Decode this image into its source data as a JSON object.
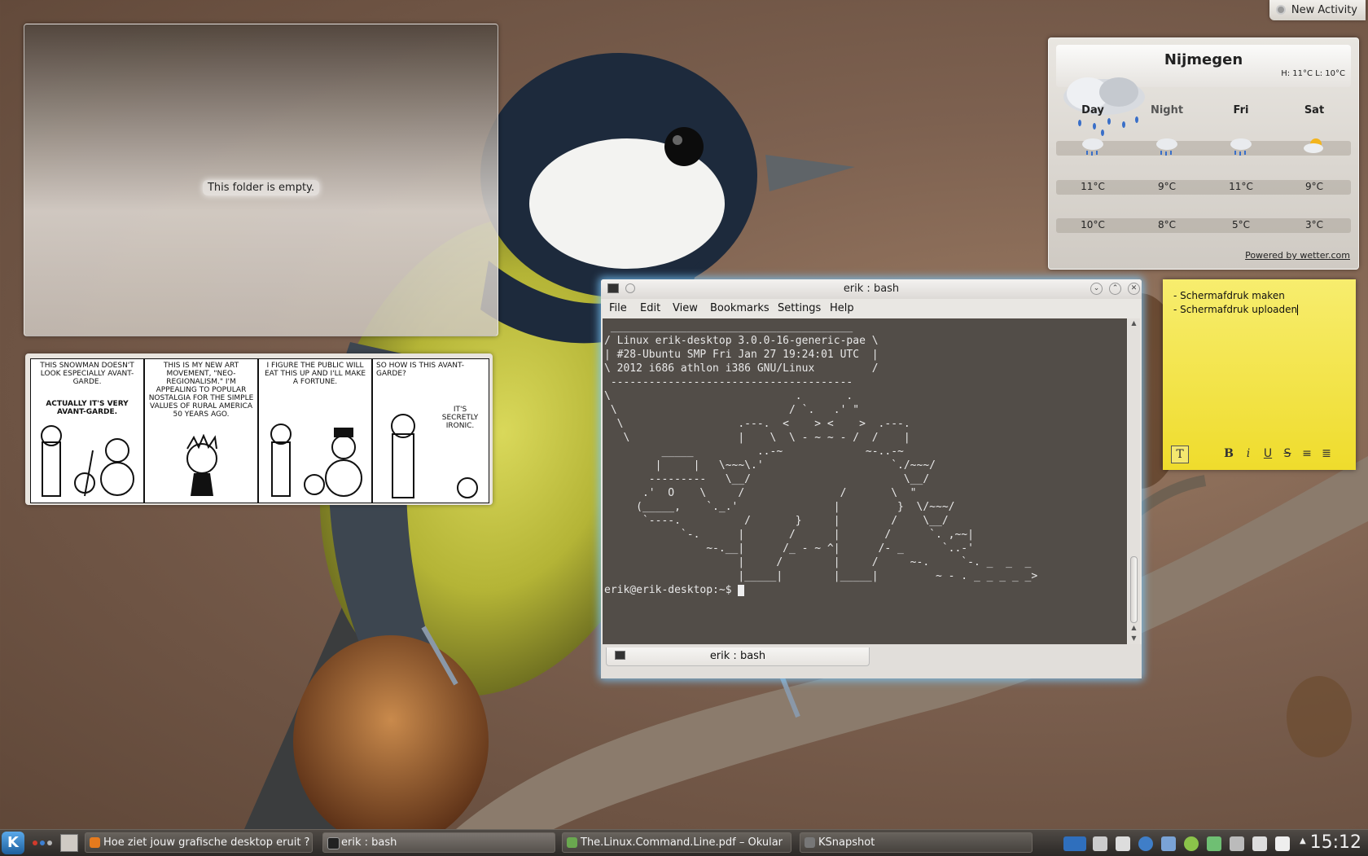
{
  "folderview": {
    "empty_text": "This folder is empty."
  },
  "comic": {
    "panels": [
      {
        "caption": "This snowman doesn't look especially avant-garde.",
        "bubble": "Actually it's very avant-garde."
      },
      {
        "caption": "This is my new art movement, \"Neo-Regionalism.\" I'm appealing to popular nostalgia for the simple values of rural America 50 years ago.",
        "bubble": ""
      },
      {
        "caption": "I figure the public will eat this up and I'll make a fortune.",
        "bubble": ""
      },
      {
        "caption": "So how is this avant-garde?",
        "bubble": "It's secretly ironic."
      }
    ]
  },
  "activity": {
    "label": "New Activity"
  },
  "weather": {
    "city": "Nijmegen",
    "high_low": "H: 11°C L: 10°C",
    "days": [
      "Day",
      "Night",
      "Fri",
      "Sat"
    ],
    "highs": [
      "11°C",
      "9°C",
      "11°C",
      "9°C"
    ],
    "lows": [
      "10°C",
      "8°C",
      "5°C",
      "3°C"
    ],
    "powered_by": "Powered by wetter.com"
  },
  "note": {
    "lines": [
      "- Schermafdruk maken",
      "- Schermafdruk uploaden"
    ],
    "tools": [
      "T",
      "B",
      "i",
      "U",
      "S",
      "≡",
      "≣"
    ]
  },
  "konsole": {
    "title": "erik : bash",
    "menu": [
      "File",
      "Edit",
      "View",
      "Bookmarks",
      "Settings",
      "Help"
    ],
    "terminal_text": " ______________________________________\n/ Linux erik-desktop 3.0.0-16-generic-pae \\\n| #28-Ubuntu SMP Fri Jan 27 19:24:01 UTC  |\n\\ 2012 i686 athlon i386 GNU/Linux         /\n --------------------------------------\n\\                             .       .\n \\                           / `.   .' \"\n  \\                  .---.  <    > <    >  .---.\n   \\                 |    \\  \\ - ~ ~ - /  /    |\n         _____          ..-~             ~-..-~\n        |     |   \\~~~\\.'                    `./~~~/\n       ---------   \\__/                        \\__/\n      .'  O    \\     /               /       \\  \"\n     (_____,    `._.'               |         }  \\/~~~/\n      `----.          /       }     |        /    \\__/\n            `-.      |       /      |       /      `. ,~~|\n                ~-.__|      /_ - ~ ^|      /- _      `..-'\n                     |     /        |     /     ~-.     `-. _  _  _\n                     |_____|        |_____|         ~ - . _ _ _ _ _>\n",
    "prompt": "erik@erik-desktop:~$ ",
    "tab_label": "erik : bash"
  },
  "taskbar": {
    "tasks": [
      "Hoe ziet jouw grafische desktop eruit ? - In",
      "erik : bash",
      "The.Linux.Command.Line.pdf – Okular",
      "KSnapshot"
    ],
    "clock": "15:12"
  }
}
